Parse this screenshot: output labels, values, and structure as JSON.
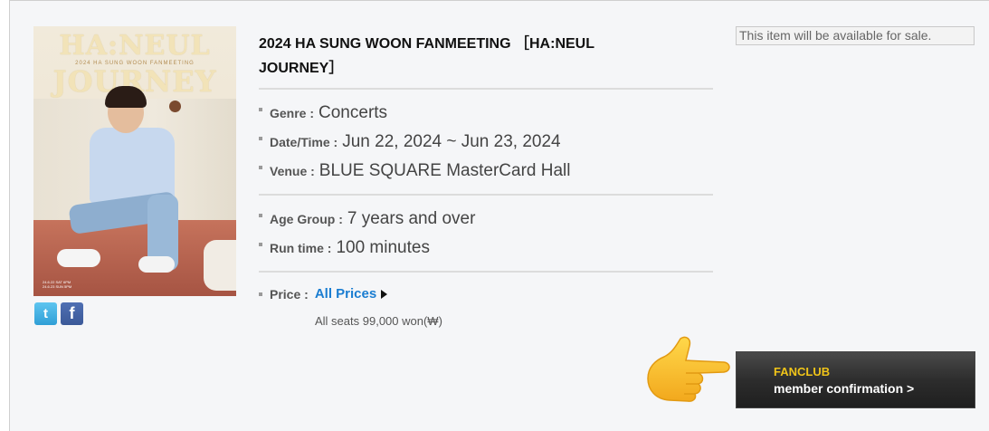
{
  "poster": {
    "title_line1": "HA:NEUL",
    "subtitle": "2024 HA SUNG WOON FANMEETING",
    "title_line2": "JOURNEY",
    "footer": "24.6.22 SAT 6PM\n24.6.23 SUN 5PM"
  },
  "social": {
    "twitter_glyph": "t",
    "facebook_glyph": "f"
  },
  "event": {
    "title": "2024 HA SUNG WOON FANMEETING ［HA:NEUL JOURNEY］",
    "genre_label": "Genre :",
    "genre": "Concerts",
    "date_label": "Date/Time :",
    "date": "Jun 22, 2024 ~ Jun 23, 2024",
    "venue_label": "Venue :",
    "venue": "BLUE SQUARE MasterCard Hall",
    "age_label": "Age Group :",
    "age": "7 years and over",
    "runtime_label": "Run time :",
    "runtime": "100 minutes",
    "price_label": "Price :",
    "price_link": "All Prices",
    "seats": "All seats  99,000 won(₩)"
  },
  "sale_notice": "This item will be available for sale.",
  "fanclub_button": {
    "line1": "FANCLUB",
    "line2": "member confirmation >"
  },
  "colors": {
    "link": "#1a7dd1",
    "fanclub_accent": "#f0c419",
    "button_bg": "#2d2d2d",
    "panel_bg": "#f5f6f8"
  }
}
